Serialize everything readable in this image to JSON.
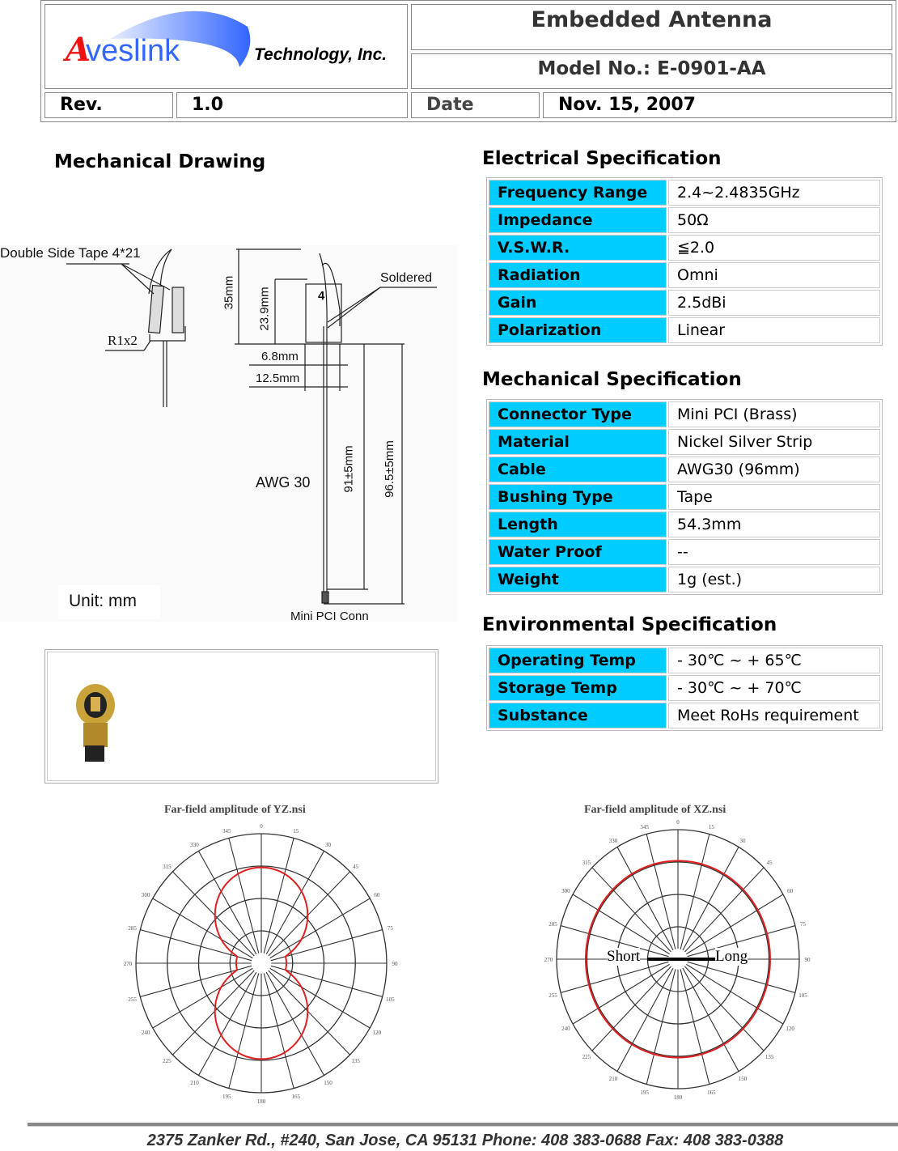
{
  "header": {
    "logo_text": "Aveslink",
    "company": "Technology, Inc.",
    "title": "Embedded Antenna",
    "model": "Model No.:  E-0901-AA",
    "rev_label": "Rev.",
    "rev_value": "1.0",
    "date_label": "Date",
    "date_value": "Nov. 15, 2007"
  },
  "drawing": {
    "title": "Mechanical Drawing",
    "labels": {
      "tape": "Double  Side Tape 4*21",
      "radius": "R1x2",
      "h35": "35mm",
      "h239": "23.9mm",
      "four": "4",
      "soldered": "Soldered",
      "w68": "6.8mm",
      "w125": "12.5mm",
      "awg": "AWG 30",
      "l91": "91±5mm",
      "l965": "96.5±5mm",
      "conn": "Mini PCI Conn",
      "unit": "Unit: mm"
    }
  },
  "electrical": {
    "title": "Electrical Specification",
    "rows": [
      {
        "k": "Frequency Range",
        "v": "2.4~2.4835GHz"
      },
      {
        "k": "Impedance",
        "v": "50Ω"
      },
      {
        "k": "V.S.W.R.",
        "v": "≦2.0"
      },
      {
        "k": "Radiation",
        "v": "Omni"
      },
      {
        "k": "Gain",
        "v": "2.5dBi"
      },
      {
        "k": "Polarization",
        "v": "Linear"
      }
    ]
  },
  "mechanical": {
    "title": "Mechanical Specification",
    "rows": [
      {
        "k": "Connector Type",
        "v": "Mini PCI (Brass)"
      },
      {
        "k": "Material",
        "v": "Nickel Silver Strip"
      },
      {
        "k": "Cable",
        "v": "AWG30 (96mm)"
      },
      {
        "k": "Bushing Type",
        "v": "Tape"
      },
      {
        "k": "Length",
        "v": "54.3mm"
      },
      {
        "k": "Water Proof",
        "v": "--"
      },
      {
        "k": "Weight",
        "v": "1g (est.)"
      }
    ]
  },
  "environmental": {
    "title": "Environmental Specification",
    "rows": [
      {
        "k": "Operating Temp",
        "v": "- 30℃ ~ + 65℃"
      },
      {
        "k": "Storage Temp",
        "v": "- 30℃ ~ + 70℃"
      },
      {
        "k": "Substance",
        "v": "Meet RoHs requirement"
      }
    ]
  },
  "patterns": [
    {
      "title": "Far-field amplitude of YZ.nsi",
      "shape": "figure-eight"
    },
    {
      "title": "Far-field amplitude of XZ.nsi",
      "shape": "omni",
      "short_label": "Short",
      "long_label": "Long"
    }
  ],
  "angle_ticks": [
    "0",
    "15",
    "30",
    "45",
    "60",
    "75",
    "90",
    "105",
    "120",
    "135",
    "150",
    "165",
    "180",
    "195",
    "210",
    "225",
    "240",
    "255",
    "270",
    "285",
    "300",
    "315",
    "330",
    "345"
  ],
  "colors": {
    "accent": "#00ccff",
    "pattern": "#e02020",
    "logo_blue": "#3366ff",
    "logo_red": "#ee1111"
  },
  "footer": "2375 Zanker Rd., #240, San Jose, CA 95131  Phone: 408 383-0688 Fax: 408 383-0388"
}
